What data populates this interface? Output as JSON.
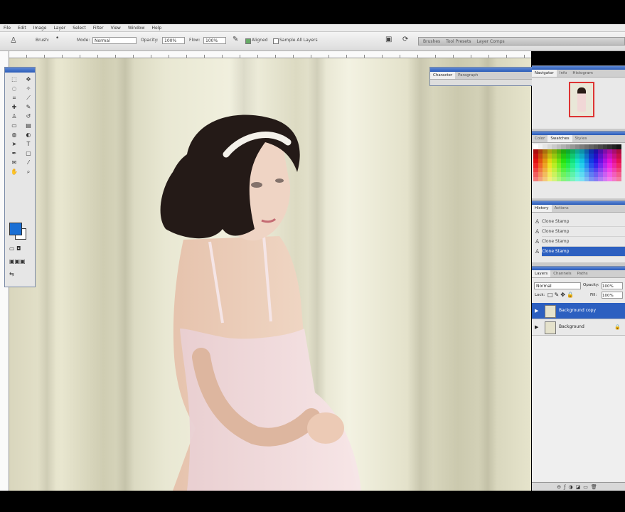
{
  "menu": [
    "File",
    "Edit",
    "Image",
    "Layer",
    "Select",
    "Filter",
    "View",
    "Window",
    "Help"
  ],
  "options": {
    "brush_label": "Brush:",
    "mode_label": "Mode:",
    "mode_value": "Normal",
    "opacity_label": "Opacity:",
    "opacity_value": "100%",
    "flow_label": "Flow:",
    "flow_value": "100%",
    "aligned_label": "Aligned",
    "sample_all_label": "Sample All Layers"
  },
  "palette_well": {
    "tabs": [
      "Brushes",
      "Tool Presets",
      "Layer Comps"
    ]
  },
  "character_panel": {
    "tabs": [
      "Character",
      "Paragraph"
    ]
  },
  "navigator_panel": {
    "tabs": [
      "Navigator",
      "Info",
      "Histogram"
    ]
  },
  "swatches_panel": {
    "tabs": [
      "Color",
      "Swatches",
      "Styles"
    ]
  },
  "history_panel": {
    "tabs": [
      "History",
      "Actions"
    ],
    "items": [
      "Clone Stamp",
      "Clone Stamp",
      "Clone Stamp",
      "Clone Stamp"
    ]
  },
  "layers_panel": {
    "tabs": [
      "Layers",
      "Channels",
      "Paths"
    ],
    "blend_mode": "Normal",
    "opacity_label": "Opacity:",
    "opacity_value": "100%",
    "lock_label": "Lock:",
    "fill_label": "Fill:",
    "fill_value": "100%",
    "layers": [
      {
        "name": "Background copy",
        "selected": true
      },
      {
        "name": "Background",
        "selected": false
      }
    ]
  },
  "colors": {
    "foreground": "#1a6fd4",
    "background": "#ffffff",
    "selection": "#2c5fc0",
    "title_bar": "#2a5bb8"
  }
}
